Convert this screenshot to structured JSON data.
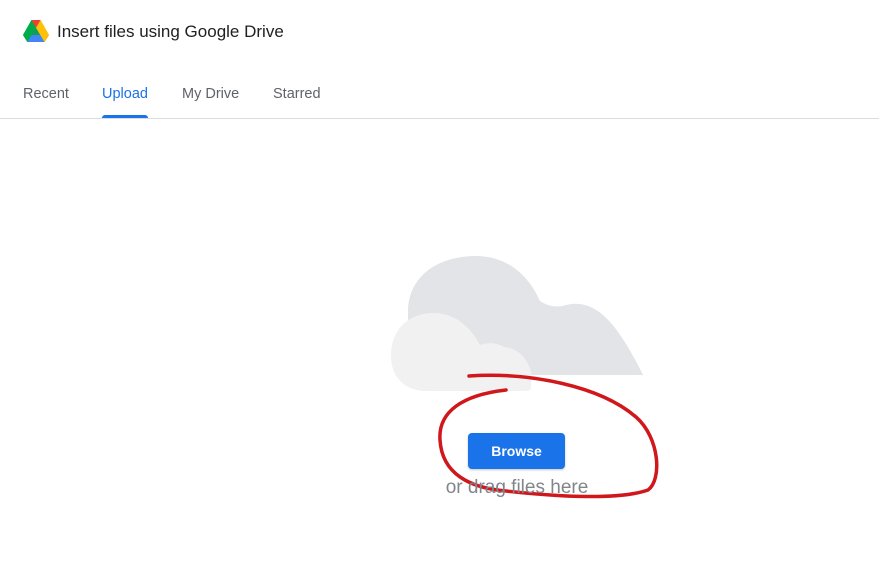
{
  "header": {
    "title": "Insert files using Google Drive",
    "logo_icon": "google-drive-icon"
  },
  "tabs": [
    {
      "label": "Recent",
      "active": false
    },
    {
      "label": "Upload",
      "active": true
    },
    {
      "label": "My Drive",
      "active": false
    },
    {
      "label": "Starred",
      "active": false
    }
  ],
  "upload": {
    "illustration_icon": "cloud-illustration",
    "browse_label": "Browse",
    "drag_text": "or drag files here"
  },
  "colors": {
    "accent": "#1a73e8",
    "tab_inactive": "#5f6368",
    "divider": "#dadce0",
    "cloud_back": "#e3e4e7",
    "cloud_front": "#f1f1f2",
    "annotation": "#d0181c"
  }
}
